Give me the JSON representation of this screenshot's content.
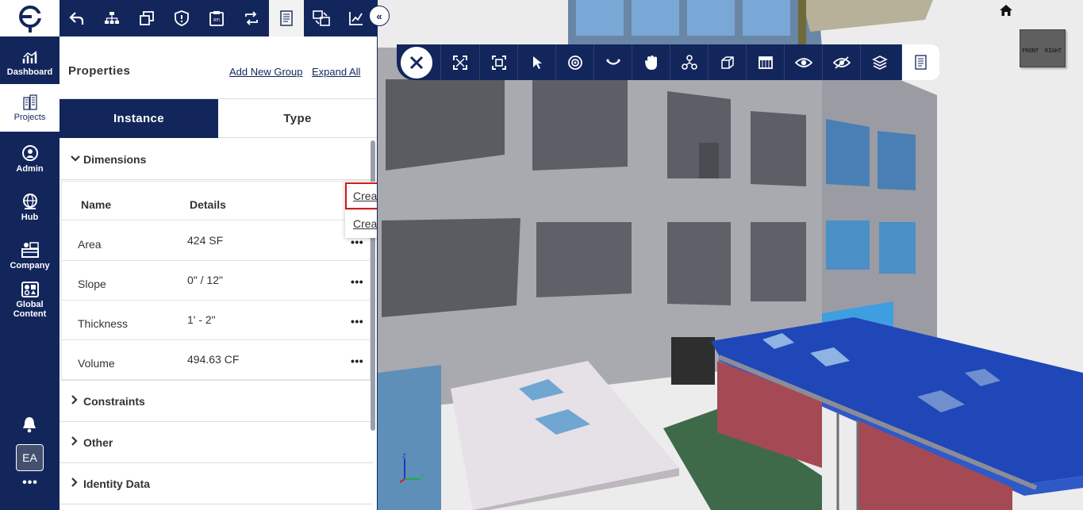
{
  "nav": {
    "logo_icon": "ecolane-e-logo-icon",
    "items": [
      {
        "label": "Dashboard",
        "icon": "chart-icon"
      },
      {
        "label": "Projects",
        "icon": "buildings-icon",
        "active": true
      },
      {
        "label": "Admin",
        "icon": "admin-user-icon"
      },
      {
        "label": "Hub",
        "icon": "globe-hub-icon"
      },
      {
        "label": "Company",
        "icon": "company-icon"
      },
      {
        "label": "Global Content",
        "icon": "global-content-icon"
      }
    ],
    "bell_icon": "bell-icon",
    "avatar": "EA",
    "more": "•••"
  },
  "panel_toolbar": {
    "buttons": [
      "back-icon",
      "hierarchy-icon",
      "copy-windows-icon",
      "shield-icon",
      "rfi-clipboard-icon",
      "swap-icon",
      "properties-sheet-icon",
      "compare-icon",
      "edit-chart-icon"
    ],
    "active_index": 6,
    "collapse_label": "«"
  },
  "panel": {
    "title": "Properties",
    "add_group_link": "Add New Group",
    "expand_all_link": "Expand All",
    "tabs": [
      {
        "label": "Instance",
        "active": true
      },
      {
        "label": "Type",
        "active": false
      }
    ],
    "sections": {
      "dimensions": "Dimensions",
      "constraints": "Constraints",
      "other": "Other",
      "identity": "Identity Data"
    },
    "table": {
      "headers": {
        "name": "Name",
        "details": "Details"
      },
      "rows": [
        {
          "name": "Area",
          "value": "424 SF"
        },
        {
          "name": "Slope",
          "value": "0\" / 12\""
        },
        {
          "name": "Thickness",
          "value": "1' - 2\""
        },
        {
          "name": "Volume",
          "value": "494.63 CF"
        }
      ],
      "more_label": "•••"
    },
    "context_menu": {
      "create_issue": "Create Issue",
      "create_rfi": "Create RFI"
    }
  },
  "viewer": {
    "toolbar": [
      "close-icon",
      "fullscreen-icon",
      "fit-frame-icon",
      "select-pointer-icon",
      "orbit-icon",
      "look-icon",
      "pan-hand-icon",
      "model-tree-icon",
      "cube-icon",
      "section-box-icon",
      "show-icon",
      "hide-icon",
      "layers-icon",
      "properties-sheet-icon"
    ],
    "active_index": 13,
    "viewcube": {
      "front": "FRONT",
      "right": "RIGHT"
    },
    "home_icon": "home-icon",
    "axis": {
      "z": "Z",
      "y": "Y"
    },
    "colors": {
      "roof_blue": "#1f47b8",
      "wall_gray": "#a9a9b0",
      "wall_red": "#a54a55",
      "glass": "#4a98cc"
    }
  }
}
